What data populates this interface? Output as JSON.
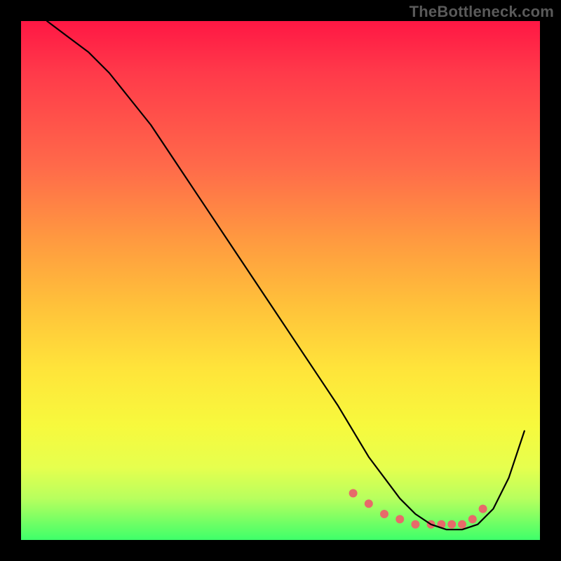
{
  "watermark": "TheBottleneck.com",
  "chart_data": {
    "type": "line",
    "title": "",
    "xlabel": "",
    "ylabel": "",
    "xlim": [
      0,
      100
    ],
    "ylim": [
      0,
      100
    ],
    "grid": false,
    "legend": false,
    "series": [
      {
        "name": "curve",
        "x": [
          5,
          9,
          13,
          17,
          21,
          25,
          29,
          33,
          37,
          41,
          45,
          49,
          53,
          57,
          61,
          64,
          67,
          70,
          73,
          76,
          79,
          82,
          85,
          88,
          91,
          94,
          97
        ],
        "values": [
          100,
          97,
          94,
          90,
          85,
          80,
          74,
          68,
          62,
          56,
          50,
          44,
          38,
          32,
          26,
          21,
          16,
          12,
          8,
          5,
          3,
          2,
          2,
          3,
          6,
          12,
          21
        ]
      }
    ],
    "highlight_points": {
      "name": "dots",
      "x": [
        64,
        67,
        70,
        73,
        76,
        79,
        81,
        83,
        85,
        87,
        89
      ],
      "values": [
        9,
        7,
        5,
        4,
        3,
        3,
        3,
        3,
        3,
        4,
        6
      ],
      "color": "#e76a6a",
      "radius": 6
    },
    "colors": {
      "line": "#000000",
      "dots": "#e76a6a",
      "frame": "#000000"
    }
  }
}
